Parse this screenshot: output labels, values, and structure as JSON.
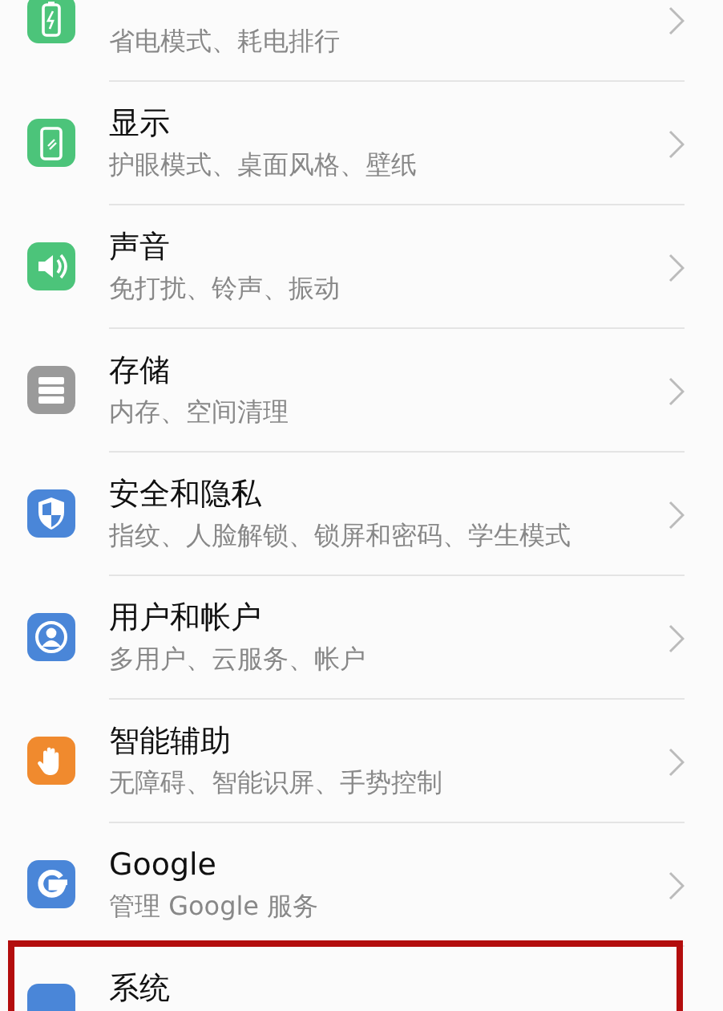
{
  "settings_items": [
    {
      "kind": "battery",
      "color": "#4cc47a",
      "subtitle": "省电模式、耗电排行",
      "highlighted": false
    },
    {
      "kind": "display",
      "color": "#4cc47a",
      "title": "显示",
      "subtitle": "护眼模式、桌面风格、壁纸",
      "highlighted": false
    },
    {
      "kind": "sound",
      "color": "#4cc47a",
      "title": "声音",
      "subtitle": "免打扰、铃声、振动",
      "highlighted": false
    },
    {
      "kind": "storage",
      "color": "#9a9a9a",
      "title": "存储",
      "subtitle": "内存、空间清理",
      "highlighted": false
    },
    {
      "kind": "shield",
      "color": "#4a86d8",
      "title": "安全和隐私",
      "subtitle": "指纹、人脸解锁、锁屏和密码、学生模式",
      "highlighted": false
    },
    {
      "kind": "user",
      "color": "#4a86d8",
      "title": "用户和帐户",
      "subtitle": "多用户、云服务、帐户",
      "highlighted": false
    },
    {
      "kind": "hand",
      "color": "#f08a2e",
      "title": "智能辅助",
      "subtitle": "无障碍、智能识屏、手势控制",
      "highlighted": false
    },
    {
      "kind": "google",
      "color": "#4a86d8",
      "title": "Google",
      "subtitle": "管理 Google 服务",
      "highlighted": false
    },
    {
      "kind": "system",
      "color": "#4a86d8",
      "title": "系统",
      "highlighted": true
    }
  ]
}
